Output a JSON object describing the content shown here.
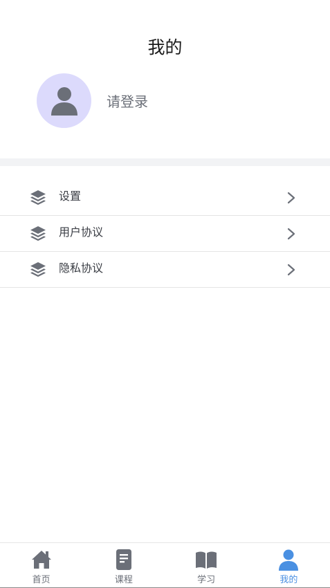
{
  "header": {
    "title": "我的"
  },
  "profile": {
    "login_prompt": "请登录"
  },
  "menu": {
    "items": [
      {
        "label": "设置",
        "icon": "layers-icon"
      },
      {
        "label": "用户协议",
        "icon": "layers-icon"
      },
      {
        "label": "隐私协议",
        "icon": "layers-icon"
      }
    ]
  },
  "tabbar": {
    "tabs": [
      {
        "label": "首页",
        "icon": "home-icon"
      },
      {
        "label": "课程",
        "icon": "document-icon"
      },
      {
        "label": "学习",
        "icon": "book-icon"
      },
      {
        "label": "我的",
        "icon": "user-icon",
        "active": true
      }
    ],
    "active_color": "#4a90e2",
    "inactive_color": "#6b6f78"
  },
  "colors": {
    "avatar_bg": "#dcdafc",
    "icon_gray": "#6b6f78"
  }
}
